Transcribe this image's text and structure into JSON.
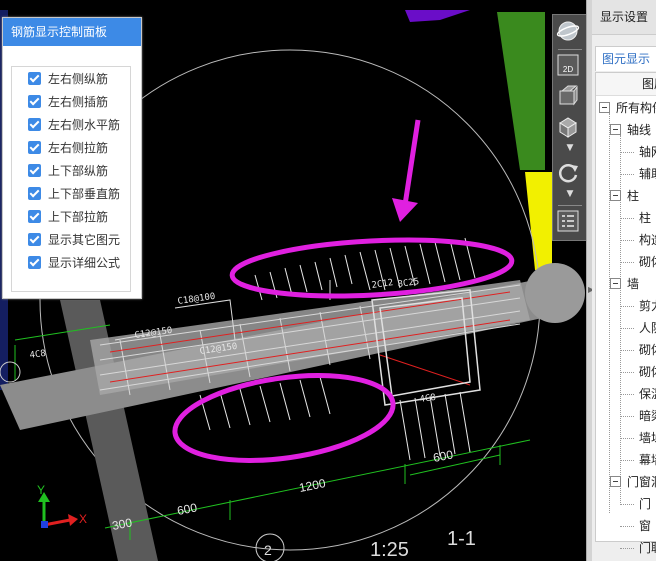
{
  "viewport": {
    "drawing_labels": {
      "c18_100": "C18@100",
      "c12_150_left": "C12@150",
      "c12_150_mid": "C12@150",
      "c12_20": "2C12",
      "c8_25": "8C25",
      "c4_upper": "4C8",
      "c4_bottom": "4C8",
      "dim_1200": "1200",
      "dim_600_left": "600",
      "dim_600_right": "600",
      "dim_300": "300",
      "section_1_1": "1-1",
      "scale": "1:25",
      "circle_no": "2",
      "axis_x": "X",
      "axis_y": "Y"
    }
  },
  "control_panel": {
    "title": "钢筋显示控制面板",
    "items": [
      {
        "label": "左右侧纵筋",
        "checked": true
      },
      {
        "label": "左右侧插筋",
        "checked": true
      },
      {
        "label": "左右侧水平筋",
        "checked": true
      },
      {
        "label": "左右侧拉筋",
        "checked": true
      },
      {
        "label": "上下部纵筋",
        "checked": true
      },
      {
        "label": "上下部垂直筋",
        "checked": true
      },
      {
        "label": "上下部拉筋",
        "checked": true
      },
      {
        "label": "显示其它图元",
        "checked": true
      },
      {
        "label": "显示详细公式",
        "checked": true
      }
    ]
  },
  "toolbar": {
    "items": [
      "globe-icon",
      "2d-view-icon",
      "3d-box-icon",
      "cube-icon",
      "rotate-icon",
      "layer-grid-icon"
    ],
    "label_2d": "2D"
  },
  "right_panel": {
    "header": "显示设置",
    "tab": "图元显示",
    "column": "图层",
    "tree": [
      {
        "label": "所有构件",
        "level": 0,
        "toggle": true
      },
      {
        "label": "轴线",
        "level": 1,
        "toggle": true
      },
      {
        "label": "轴网",
        "level": 2,
        "toggle": false
      },
      {
        "label": "辅助",
        "level": 2,
        "toggle": false
      },
      {
        "label": "柱",
        "level": 1,
        "toggle": true
      },
      {
        "label": "柱",
        "level": 2,
        "toggle": false
      },
      {
        "label": "构造",
        "level": 2,
        "toggle": false
      },
      {
        "label": "砌体",
        "level": 2,
        "toggle": false
      },
      {
        "label": "墙",
        "level": 1,
        "toggle": true
      },
      {
        "label": "剪力",
        "level": 2,
        "toggle": false
      },
      {
        "label": "人防",
        "level": 2,
        "toggle": false
      },
      {
        "label": "砌体",
        "level": 2,
        "toggle": false
      },
      {
        "label": "砌体",
        "level": 2,
        "toggle": false
      },
      {
        "label": "保温",
        "level": 2,
        "toggle": false
      },
      {
        "label": "暗梁",
        "level": 2,
        "toggle": false
      },
      {
        "label": "墙垛",
        "level": 2,
        "toggle": false
      },
      {
        "label": "幕墙",
        "level": 2,
        "toggle": false
      },
      {
        "label": "门窗洞",
        "level": 1,
        "toggle": true
      },
      {
        "label": "门",
        "level": 2,
        "toggle": false
      },
      {
        "label": "窗",
        "level": 2,
        "toggle": false
      },
      {
        "label": "门联",
        "level": 2,
        "toggle": false
      }
    ]
  }
}
